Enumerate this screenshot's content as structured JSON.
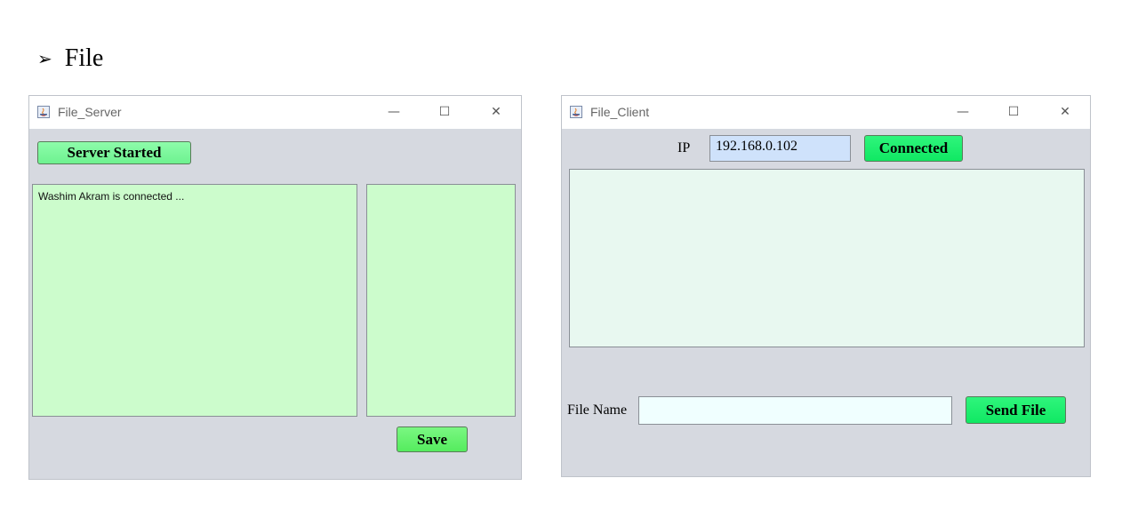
{
  "heading": {
    "bullet": "➢",
    "text": "File"
  },
  "server": {
    "title": "File_Server",
    "controls": {
      "minimize": "—",
      "maximize": "☐",
      "close": "✕"
    },
    "start_button": "Server Started",
    "log_text": "Washim Akram is connected ...",
    "file_area_text": "",
    "save_button": "Save"
  },
  "client": {
    "title": "File_Client",
    "controls": {
      "minimize": "—",
      "maximize": "☐",
      "close": "✕"
    },
    "ip_label": "IP",
    "ip_value": "192.168.0.102",
    "connect_button": "Connected",
    "message_area_text": "",
    "file_name_label": "File Name",
    "file_name_value": "",
    "send_button": "Send File"
  },
  "colors": {
    "window_bg": "#d6d9e0",
    "server_button": "#7dfa9c",
    "server_log_bg": "#ccfccc",
    "save_button": "#66f56e",
    "client_ip_field": "#cfe2fb",
    "client_button": "#18f26c",
    "client_message_bg": "#e8f8f0",
    "client_file_field": "#f0ffff"
  }
}
